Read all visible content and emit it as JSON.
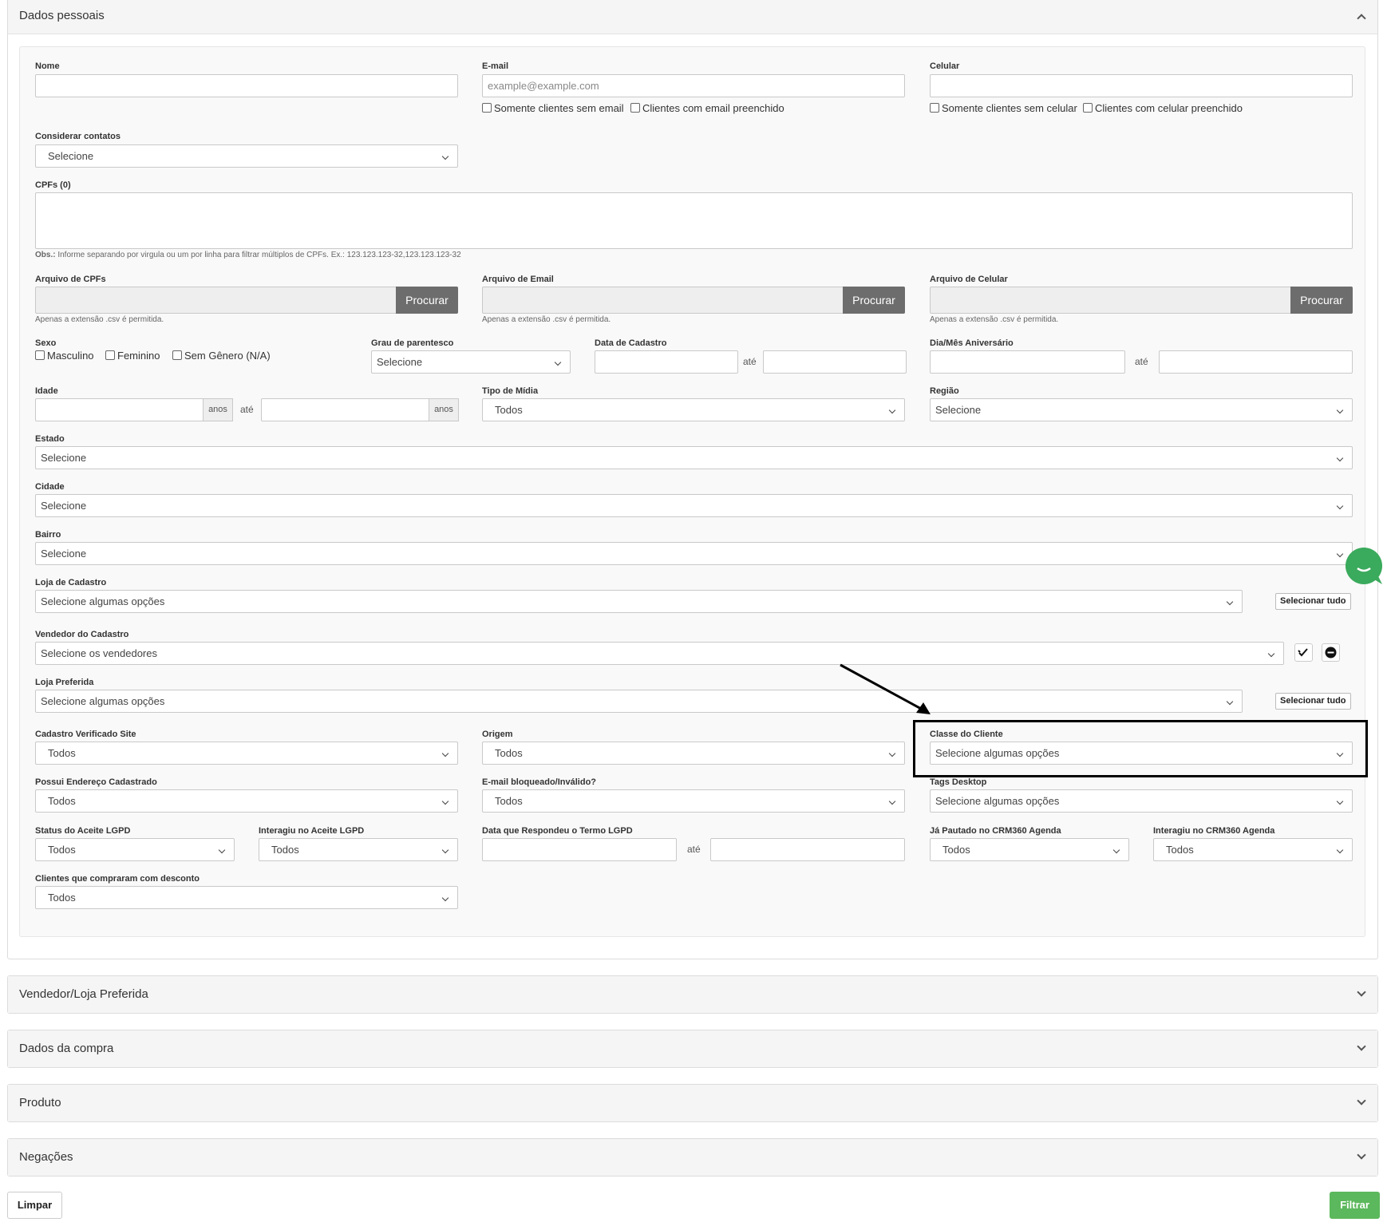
{
  "panels": {
    "dados_pessoais": "Dados pessoais",
    "vendedor_loja": "Vendedor/Loja Preferida",
    "dados_compra": "Dados da compra",
    "produto": "Produto",
    "negacoes": "Negações"
  },
  "form": {
    "nome": {
      "label": "Nome",
      "value": ""
    },
    "email": {
      "label": "E-mail",
      "placeholder": "example@example.com",
      "chk1": "Somente clientes sem email",
      "chk2": "Clientes com email preenchido"
    },
    "celular": {
      "label": "Celular",
      "chk1": "Somente clientes sem celular",
      "chk2": "Clientes com celular preenchido"
    },
    "considerar": {
      "label": "Considerar contatos",
      "value": "Selecione"
    },
    "cpfs": {
      "label": "CPFs (0)",
      "obs_bold": "Obs.:",
      "obs": " Informe separando por virgula ou um por linha para filtrar múltiplos de CPFs. Ex.: 123.123.123-32,123.123.123-32"
    },
    "arquivo_cpfs": {
      "label": "Arquivo de CPFs",
      "button": "Procurar",
      "hint": "Apenas a extensão .csv é permitida."
    },
    "arquivo_email": {
      "label": "Arquivo de Email",
      "button": "Procurar",
      "hint": "Apenas a extensão .csv é permitida."
    },
    "arquivo_celular": {
      "label": "Arquivo de Celular",
      "button": "Procurar",
      "hint": "Apenas a extensão .csv é permitida."
    },
    "sexo": {
      "label": "Sexo",
      "opt1": "Masculino",
      "opt2": "Feminino",
      "opt3": "Sem Gênero (N/A)"
    },
    "grau": {
      "label": "Grau de parentesco",
      "value": "Selecione"
    },
    "data_cadastro": {
      "label": "Data de Cadastro",
      "ate": "até"
    },
    "aniversario": {
      "label": "Dia/Mês Aniversário",
      "ate": "até"
    },
    "idade": {
      "label": "Idade",
      "addon": "anos",
      "ate": "até"
    },
    "tipo_midia": {
      "label": "Tipo de Mídia",
      "value": "Todos"
    },
    "regiao": {
      "label": "Região",
      "value": "Selecione"
    },
    "estado": {
      "label": "Estado",
      "value": "Selecione"
    },
    "cidade": {
      "label": "Cidade",
      "value": "Selecione"
    },
    "bairro": {
      "label": "Bairro",
      "value": "Selecione"
    },
    "loja_cadastro": {
      "label": "Loja de Cadastro",
      "value": "Selecione algumas opções",
      "button": "Selecionar tudo"
    },
    "vendedor_cadastro": {
      "label": "Vendedor do Cadastro",
      "value": "Selecione os vendedores"
    },
    "loja_preferida": {
      "label": "Loja Preferida",
      "value": "Selecione algumas opções",
      "button": "Selecionar tudo"
    },
    "cadastro_verificado": {
      "label": "Cadastro Verificado Site",
      "value": "Todos"
    },
    "origem": {
      "label": "Origem",
      "value": "Todos"
    },
    "classe_cliente": {
      "label": "Classe do Cliente",
      "value": "Selecione algumas opções"
    },
    "possui_endereco": {
      "label": "Possui Endereço Cadastrado",
      "value": "Todos"
    },
    "email_bloqueado": {
      "label": "E-mail bloqueado/Inválido?",
      "value": "Todos"
    },
    "tags_desktop": {
      "label": "Tags Desktop",
      "value": "Selecione algumas opções"
    },
    "status_lgpd": {
      "label": "Status do Aceite LGPD",
      "value": "Todos"
    },
    "interagiu_lgpd": {
      "label": "Interagiu no Aceite LGPD",
      "value": "Todos"
    },
    "data_termo": {
      "label": "Data que Respondeu o Termo LGPD",
      "ate": "até"
    },
    "ja_pautado": {
      "label": "Já Pautado no CRM360 Agenda",
      "value": "Todos"
    },
    "interagiu_crm": {
      "label": "Interagiu no CRM360 Agenda",
      "value": "Todos"
    },
    "desconto": {
      "label": "Clientes que compraram com desconto",
      "value": "Todos"
    }
  },
  "footer": {
    "limpar": "Limpar",
    "filtrar": "Filtrar"
  },
  "colors": {
    "filtrar_bg": "#5cb85c",
    "chat_bubble": "#3aaa5c",
    "highlight": "#000000"
  }
}
